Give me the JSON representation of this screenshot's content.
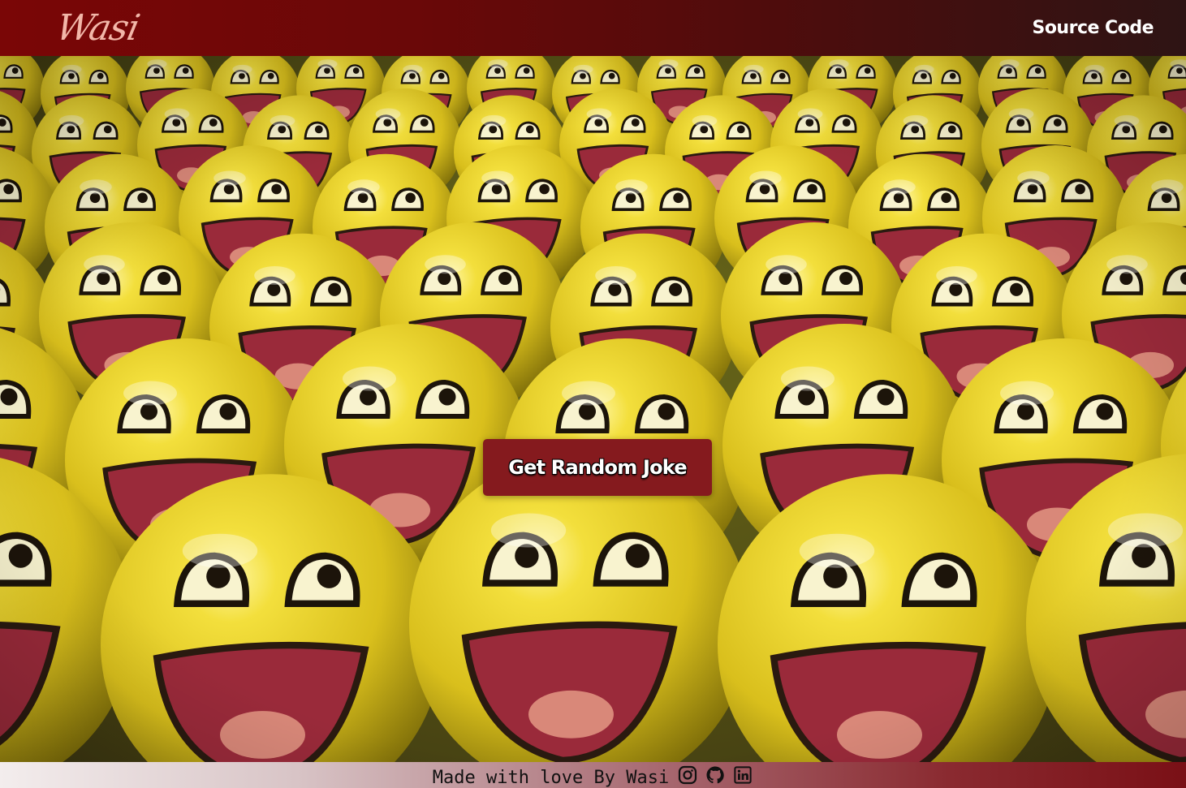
{
  "navbar": {
    "logo_text": "Wasi",
    "source_code_label": "Source Code"
  },
  "main": {
    "button_label": "Get Random Joke"
  },
  "footer": {
    "text": "Made with love By Wasi",
    "social_icons": [
      "instagram-icon",
      "github-icon",
      "linkedin-icon"
    ]
  },
  "colors": {
    "nav_start": "#7a0606",
    "nav_end": "#2e1414",
    "button_bg": "#851a1e",
    "smiley_yellow": "#e8d22a",
    "mouth_red": "#9a2a3a"
  }
}
